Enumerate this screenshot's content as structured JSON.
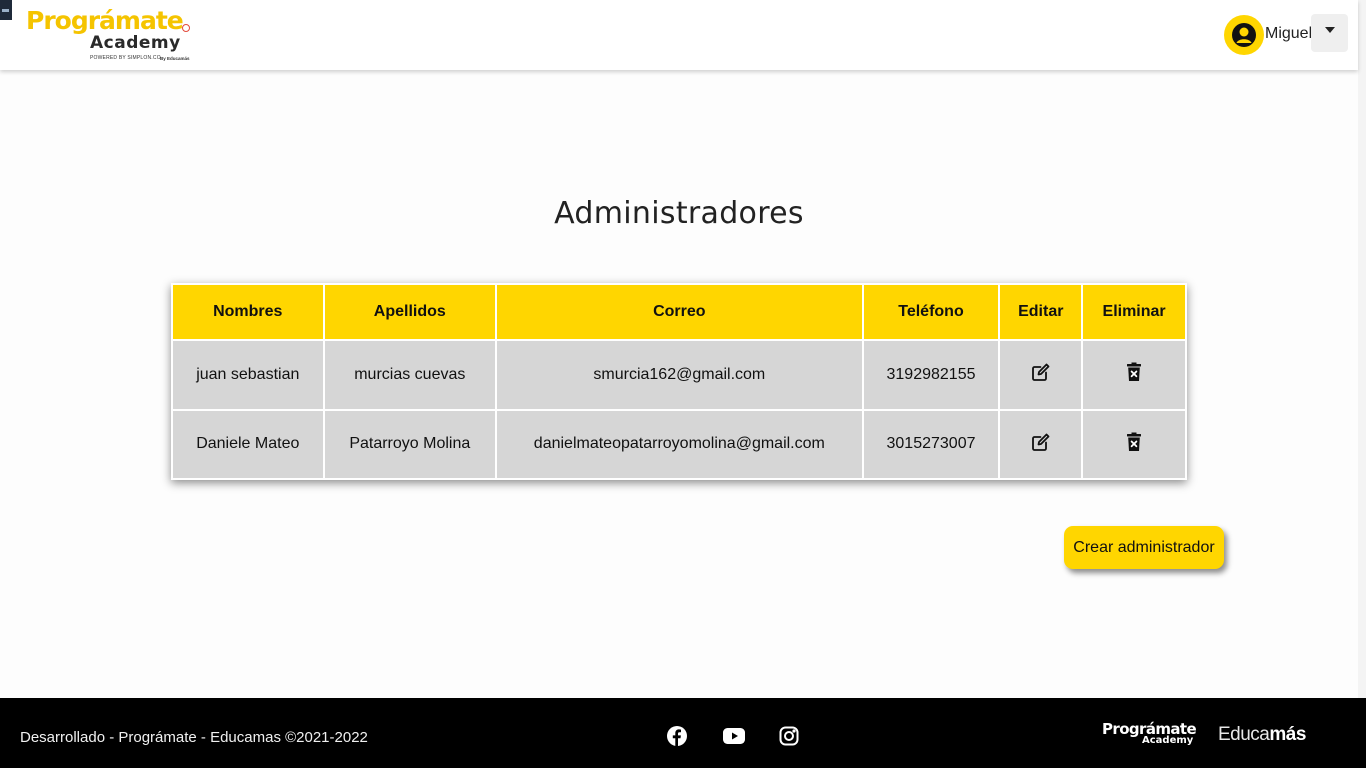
{
  "header": {
    "logo": {
      "brand": "Prográmate",
      "sub": "Academy",
      "powered": "POWERED BY SIMPLON.CO",
      "by": "By Educamás"
    },
    "user": {
      "name": "Miguel",
      "avatar_icon": "user-circle-icon",
      "dropdown_icon": "caret-down-icon"
    }
  },
  "main": {
    "title": "Administradores",
    "table": {
      "headers": [
        "Nombres",
        "Apellidos",
        "Correo",
        "Teléfono",
        "Editar",
        "Eliminar"
      ],
      "rows": [
        {
          "nombres": "juan sebastian",
          "apellidos": "murcias cuevas",
          "correo": "smurcia162@gmail.com",
          "telefono": "3192982155"
        },
        {
          "nombres": "Daniele Mateo",
          "apellidos": "Patarroyo Molina",
          "correo": "danielmateopatarroyomolina@gmail.com",
          "telefono": "3015273007"
        }
      ],
      "edit_icon": "edit-icon",
      "delete_icon": "trash-icon"
    },
    "create_button": "Crear administrador"
  },
  "footer": {
    "text": "Desarrollado - Prográmate - Educamas ©2021-2022",
    "social_icons": [
      "facebook-icon",
      "youtube-icon",
      "instagram-icon"
    ],
    "logo1": {
      "brand": "Prográmate",
      "sub": "Academy"
    },
    "logo2": {
      "light": "Educa",
      "bold": "más"
    }
  },
  "colors": {
    "accent": "#ffd600",
    "cell_bg": "#d6d6d6",
    "footer_bg": "#000000"
  }
}
